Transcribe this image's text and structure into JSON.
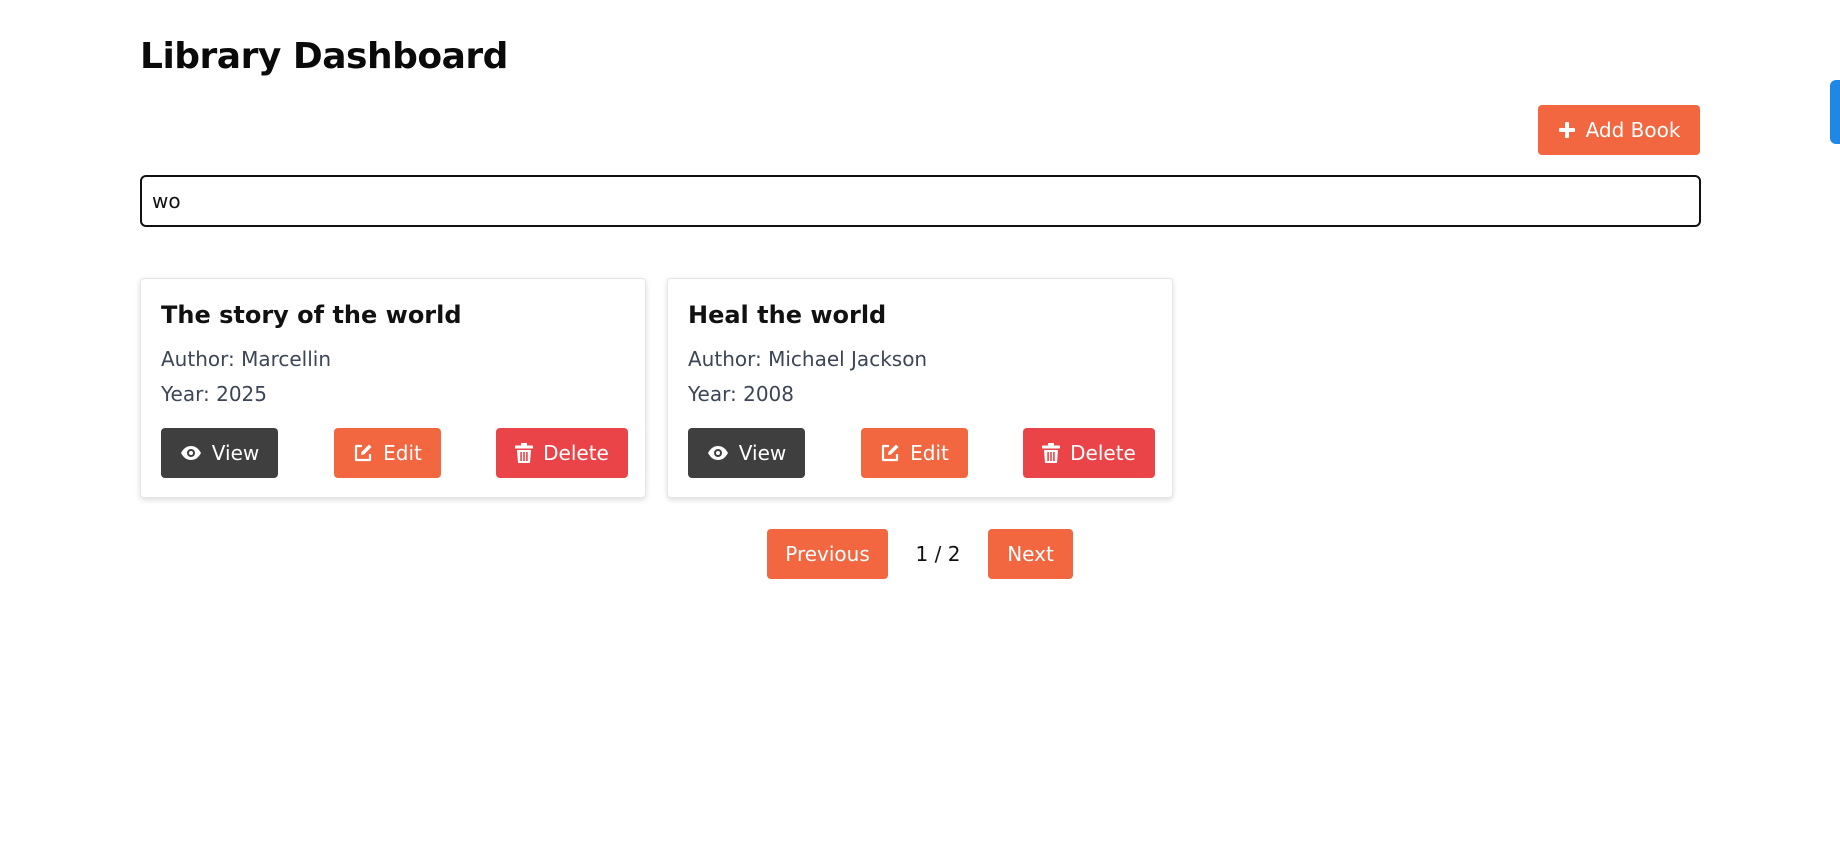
{
  "header": {
    "title": "Library Dashboard"
  },
  "toolbar": {
    "add_book_label": "Add Book",
    "add_icon": "plus-icon"
  },
  "search": {
    "value": "wo",
    "placeholder": ""
  },
  "books": [
    {
      "title": "The story of the world",
      "author": "Author: Marcellin",
      "year": "Year: 2025"
    },
    {
      "title": "Heal the world",
      "author": "Author: Michael Jackson",
      "year": "Year: 2008"
    }
  ],
  "card_actions": {
    "view_label": "View",
    "edit_label": "Edit",
    "delete_label": "Delete",
    "view_icon": "eye-icon",
    "edit_icon": "edit-icon",
    "delete_icon": "trash-icon"
  },
  "pagination": {
    "previous_label": "Previous",
    "page_info": "1 / 2",
    "next_label": "Next"
  },
  "colors": {
    "primary": "#f26640",
    "danger": "#ea4348",
    "dark": "#3f3f3f",
    "edge_tab": "#1e88e5"
  }
}
